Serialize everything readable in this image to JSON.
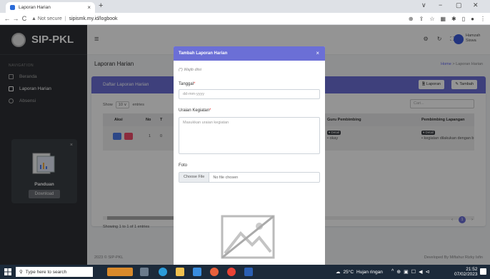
{
  "browser": {
    "tab_title": "Laporan Harian",
    "tab_close": "×",
    "new_tab": "+",
    "back": "←",
    "forward": "→",
    "reload": "C",
    "security": "▲ Not secure",
    "separator": "|",
    "url": "sipismk.my.id/logbook",
    "win_min": "−",
    "win_max": "▢",
    "win_close": "✕",
    "win_dropdown": "∨",
    "icons": [
      "⊕",
      "⇪",
      "☆",
      "▦",
      "✱",
      "▯",
      "●",
      "⋮"
    ]
  },
  "sidebar": {
    "brand": "SIP-PKL",
    "nav_heading": "NAVIGATION",
    "items": [
      {
        "label": "Beranda",
        "active": false
      },
      {
        "label": "Laporan Harian",
        "active": true
      },
      {
        "label": "Absensi",
        "active": false
      }
    ],
    "promo": {
      "close": "×",
      "title": "Panduan",
      "button": "Download"
    }
  },
  "topnav": {
    "hamburger": "≡",
    "icons": [
      "⚙",
      "↻",
      "⛶"
    ],
    "user_name": "Hamzah Siswa"
  },
  "content": {
    "page_title": "Laporan Harian",
    "breadcrumb_home": "Home",
    "breadcrumb_sep": ">",
    "breadcrumb_current": "Laporan Harian",
    "card_title": "Daftar Laporan Harian",
    "btn_laporan": "🖹 Laporan",
    "btn_tambah": "✎ Tambah",
    "show_label": "Show",
    "show_value": "10 ∨",
    "entries_label": "entries",
    "search_placeholder": "Cari...",
    "columns": [
      "Aksi",
      "No",
      "T",
      "Guru Pembimbing",
      "Pembimbing Lapangan"
    ],
    "row": {
      "no": "1",
      "tanggal": "0",
      "detail": "▾ Detail",
      "guru_item": "• okay",
      "lapangan_item": "• kegiatan dilakukan dengan b"
    },
    "entries_info": "Showing 1 to 1 of 1 entries",
    "pager_prev": "‹",
    "pager_current": "1",
    "pager_next": "›",
    "footer_left": "2023 © SIP-PKL",
    "footer_right": "Developed By Miftahur Rizky Isfin"
  },
  "modal": {
    "title": "Tambah Laporan Harian",
    "close": "×",
    "note": "(*) Wajib diisi",
    "tanggal_label": "Tanggal",
    "tanggal_placeholder": "dd-mm-yyyy",
    "uraian_label": "Uraian Kegiatan",
    "uraian_placeholder": "Masukkan uraian kegiatan",
    "required_mark": "*",
    "foto_label": "Foto",
    "choose_file": "Choose File",
    "no_file": "No file chosen"
  },
  "taskbar": {
    "search_placeholder": "Type here to search",
    "weather_temp": "25°C",
    "weather_text": "Hujan ringan",
    "tray": [
      "^",
      "⊕",
      "▣",
      "☐",
      "◀",
      "⊲"
    ],
    "time": "21:52",
    "date": "07/02/2023"
  },
  "colors": {
    "accent": "#6b6fd6",
    "sidebar": "#2d3035",
    "taskbar": "#1c2a3a",
    "danger": "#f04a6a",
    "info": "#4c7be8"
  }
}
